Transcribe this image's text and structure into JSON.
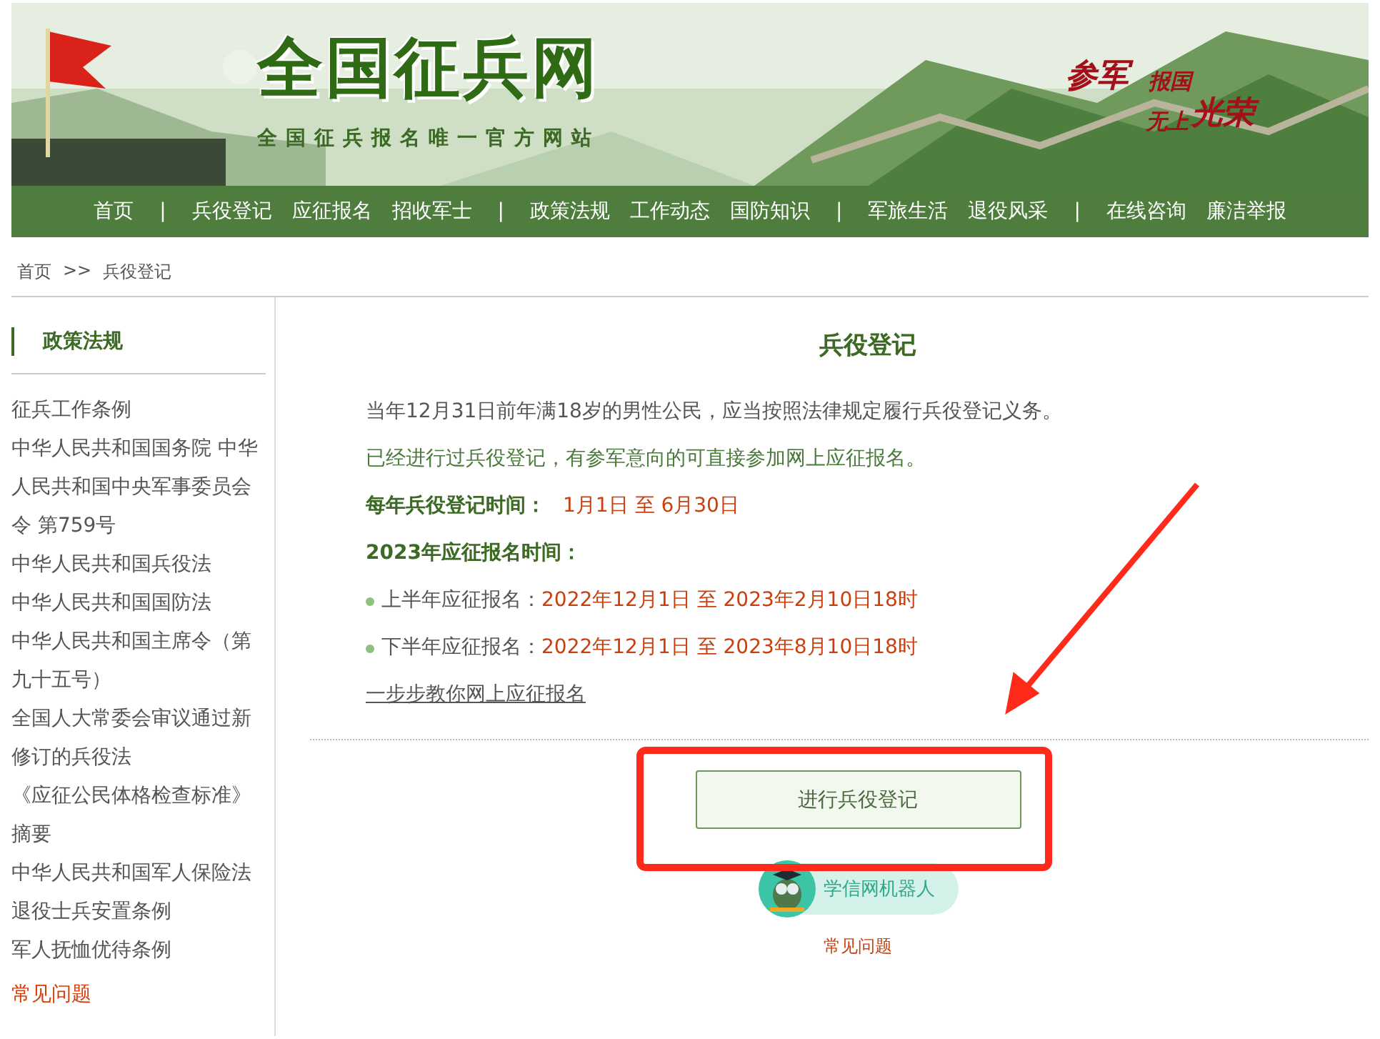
{
  "header": {
    "site_title": "全国征兵网",
    "site_subtitle": "全国征兵报名唯一官方网站",
    "slogan": [
      "参军",
      "报国",
      "无上",
      "光荣"
    ]
  },
  "nav": [
    {
      "kind": "link",
      "label": "首页"
    },
    {
      "kind": "separator",
      "label": "|"
    },
    {
      "kind": "link",
      "label": "兵役登记"
    },
    {
      "kind": "link",
      "label": "应征报名"
    },
    {
      "kind": "link",
      "label": "招收军士"
    },
    {
      "kind": "separator",
      "label": "|"
    },
    {
      "kind": "link",
      "label": "政策法规"
    },
    {
      "kind": "link",
      "label": "工作动态"
    },
    {
      "kind": "link",
      "label": "国防知识"
    },
    {
      "kind": "separator",
      "label": "|"
    },
    {
      "kind": "link",
      "label": "军旅生活"
    },
    {
      "kind": "link",
      "label": "退役风采"
    },
    {
      "kind": "separator",
      "label": "|"
    },
    {
      "kind": "link",
      "label": "在线咨询"
    },
    {
      "kind": "link",
      "label": "廉洁举报"
    }
  ],
  "breadcrumb": {
    "home": "首页",
    "separator": ">>",
    "current": "兵役登记"
  },
  "sidebar": {
    "heading": "政策法规",
    "items": [
      "征兵工作条例",
      "中华人民共和国国务院 中华人民共和国中央军事委员会令 第759号",
      "中华人民共和国兵役法",
      "中华人民共和国国防法",
      "中华人民共和国主席令（第九十五号）",
      "全国人大常委会审议通过新修订的兵役法",
      "《应征公民体格检查标准》摘要",
      "中华人民共和国军人保险法",
      "退役士兵安置条例",
      "军人抚恤优待条例"
    ],
    "faq": "常见问题"
  },
  "main": {
    "title": "兵役登记",
    "paragraphs": [
      {
        "color": "#555555",
        "text": "当年12月31日前年满18岁的男性公民，应当按照法律规定履行兵役登记义务。"
      },
      {
        "color": "#4a7a3a",
        "text": "已经进行过兵役登记，有参军意向的可直接参加网上应征报名。"
      }
    ],
    "registration_period": {
      "label": "每年兵役登记时间：",
      "value": "1月1日 至 6月30日"
    },
    "enlistment": {
      "heading": "2023年应征报名时间：",
      "rows": [
        {
          "label": "上半年应征报名：",
          "value": "2022年12月1日 至 2023年2月10日18时"
        },
        {
          "label": "下半年应征报名：",
          "value": "2022年12月1日 至 2023年8月10日18时"
        }
      ]
    },
    "guide_link": "一步步教你网上应征报名",
    "register_button": "进行兵役登记",
    "robot": "学信网机器人",
    "faq_link": "常见问题"
  }
}
